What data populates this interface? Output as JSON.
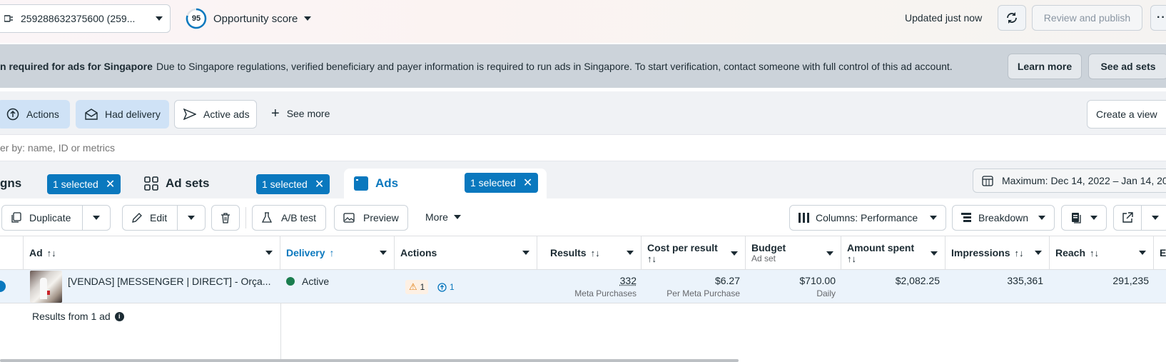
{
  "topbar": {
    "account": "259288632375600 (259...",
    "score_value": "95",
    "score_label": "Opportunity score",
    "updated": "Updated just now",
    "review_publish": "Review and publish"
  },
  "banner": {
    "title": "n required for ads for Singapore",
    "message": "Due to Singapore regulations, verified beneficiary and payer information is required to run ads in Singapore. To start verification, contact someone with full control of this ad account.",
    "learn_more": "Learn more",
    "see_ad_sets": "See ad sets"
  },
  "filters": {
    "actions": "Actions",
    "had_delivery": "Had delivery",
    "active_ads": "Active ads",
    "see_more": "See more",
    "create_view": "Create a view"
  },
  "search": {
    "placeholder": "er by: name, ID or metrics"
  },
  "tabs": {
    "campaigns": "gns",
    "campaigns_selected": "1 selected",
    "adsets": "Ad sets",
    "adsets_selected": "1 selected",
    "ads": "Ads",
    "ads_selected": "1 selected",
    "date_range": "Maximum: Dec 14, 2022 – Jan 14, 20"
  },
  "toolbar": {
    "duplicate": "Duplicate",
    "edit": "Edit",
    "ab_test": "A/B test",
    "preview": "Preview",
    "more": "More",
    "columns": "Columns: Performance",
    "breakdown": "Breakdown"
  },
  "table": {
    "headers": {
      "ad": "Ad",
      "delivery": "Delivery",
      "actions": "Actions",
      "results": "Results",
      "cost_per_result": "Cost per result",
      "budget": "Budget",
      "budget_sub": "Ad set",
      "amount_spent": "Amount spent",
      "impressions": "Impressions",
      "reach": "Reach",
      "extra": "E"
    },
    "row": {
      "ad_name": "[VENDAS] [MESSENGER | DIRECT] - Orça...",
      "delivery": "Active",
      "warnings": "1",
      "recommendations": "1",
      "results": "332",
      "results_sub": "Meta Purchases",
      "cost_per_result": "$6.27",
      "cost_per_result_sub": "Per Meta Purchase",
      "budget": "$710.00",
      "budget_sub": "Daily",
      "amount_spent": "$2,082.25",
      "impressions": "335,361",
      "reach": "291,235"
    },
    "footer": "Results from 1 ad"
  },
  "colors": {
    "accent": "#0a78be",
    "active_green": "#1a7d4e",
    "warning": "#e07d10"
  }
}
